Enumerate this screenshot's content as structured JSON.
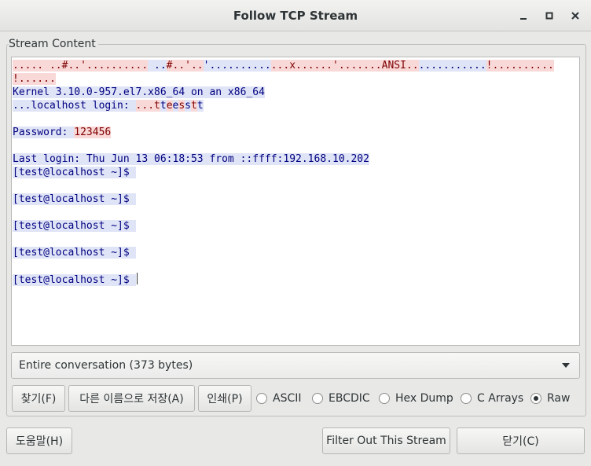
{
  "window": {
    "title": "Follow TCP Stream",
    "minimize_icon": "minimize-icon",
    "maximize_icon": "maximize-icon",
    "close_icon": "close-icon"
  },
  "stream_group": {
    "label": "Stream Content"
  },
  "stream": {
    "lines": [
      [
        [
          "c",
          "..... ..#..'.........."
        ],
        [
          "s",
          " .."
        ],
        [
          "c",
          "#..'.."
        ],
        [
          "s",
          "'.........."
        ],
        [
          "c",
          "...x......'.......ANSI.."
        ],
        [
          "s",
          "..........."
        ],
        [
          "c",
          "!.........."
        ]
      ],
      [
        [
          "c",
          "!......"
        ]
      ],
      [
        [
          "s",
          "Kernel 3.10.0-957.el7.x86_64 on an x86_64"
        ]
      ],
      [
        [
          "s",
          "..."
        ],
        [
          "s",
          "localhost login: "
        ],
        [
          "c",
          "..."
        ],
        [
          "c",
          "t"
        ],
        [
          "s",
          "t"
        ],
        [
          "c",
          "e"
        ],
        [
          "s",
          "e"
        ],
        [
          "c",
          "s"
        ],
        [
          "s",
          "s"
        ],
        [
          "c",
          "t"
        ],
        [
          "s",
          "t"
        ]
      ],
      [],
      [
        [
          "s",
          "Password: "
        ],
        [
          "c",
          "123456"
        ]
      ],
      [],
      [
        [
          "s",
          "Last login: Thu Jun 13 06:18:53 from ::ffff:192.168.10.202"
        ]
      ],
      [
        [
          "s",
          "[test@localhost ~]$ "
        ]
      ],
      [],
      [
        [
          "s",
          "[test@localhost ~]$ "
        ]
      ],
      [],
      [
        [
          "s",
          "[test@localhost ~]$ "
        ]
      ],
      [],
      [
        [
          "s",
          "[test@localhost ~]$ "
        ]
      ],
      [],
      [
        [
          "s",
          "[test@localhost ~]$ "
        ]
      ]
    ]
  },
  "conversation_select": {
    "value": "Entire conversation (373 bytes)"
  },
  "buttons": {
    "find": "찾기(F)",
    "save_as": "다른 이름으로 저장(A)",
    "print": "인쇄(P)",
    "help": "도움말(H)",
    "filter_out": "Filter Out This Stream",
    "close": "닫기(C)"
  },
  "formats": {
    "options": [
      "ASCII",
      "EBCDIC",
      "Hex Dump",
      "C Arrays",
      "Raw"
    ],
    "selected": "Raw"
  },
  "colors": {
    "client_bg": "#f9d8d8",
    "client_fg": "#7f0000",
    "server_bg": "#dfe4f6",
    "server_fg": "#000080"
  }
}
